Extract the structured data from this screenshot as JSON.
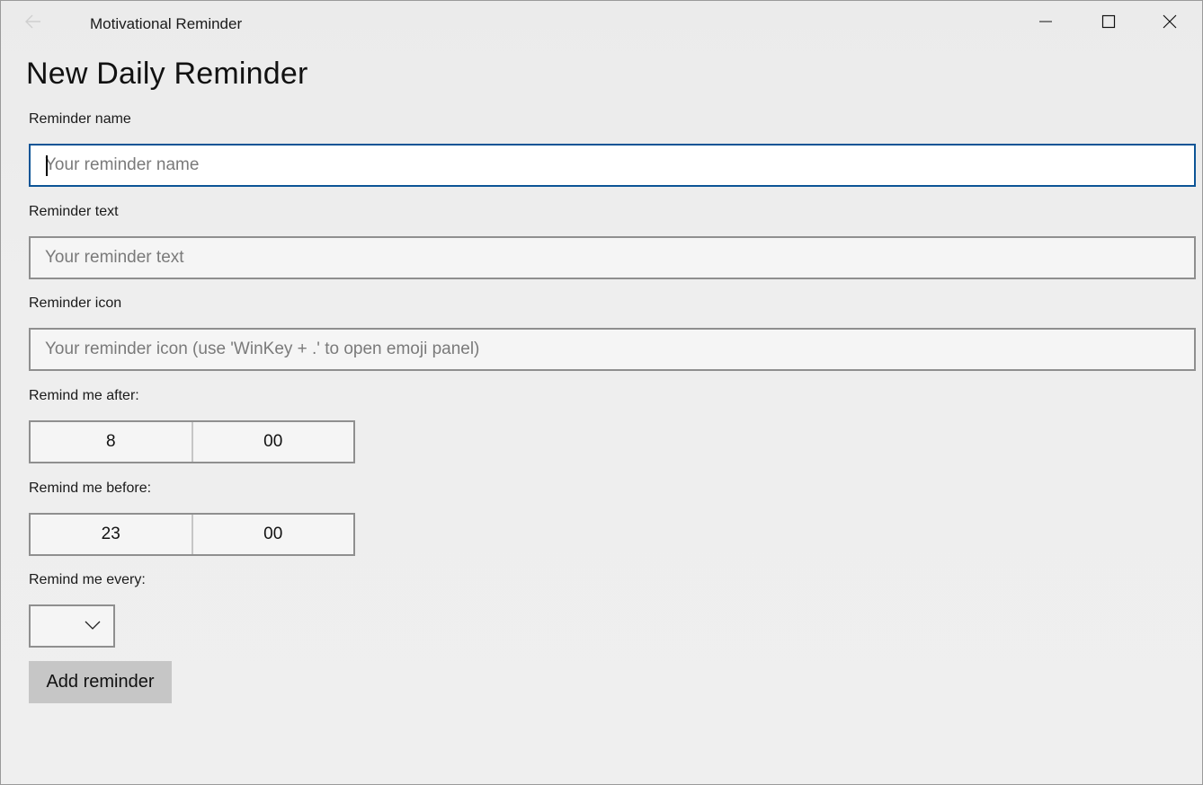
{
  "window": {
    "title": "Motivational Reminder"
  },
  "page": {
    "title": "New Daily Reminder"
  },
  "form": {
    "name_label": "Reminder name",
    "name_placeholder": "Your reminder name",
    "text_label": "Reminder text",
    "text_placeholder": "Your reminder text",
    "icon_label": "Reminder icon",
    "icon_placeholder": "Your reminder icon (use 'WinKey + .' to open emoji panel)",
    "after_label": "Remind me after:",
    "after_hour": "8",
    "after_minute": "00",
    "before_label": "Remind me before:",
    "before_hour": "23",
    "before_minute": "00",
    "every_label": "Remind me every:",
    "every_value": "",
    "submit_label": "Add reminder"
  },
  "icons": {
    "back": "back-arrow-icon",
    "minimize": "minimize-icon",
    "maximize": "maximize-icon",
    "close": "close-icon",
    "dropdown": "chevron-down-icon"
  },
  "colors": {
    "focus_border": "#0d5596",
    "button_bg": "#c6c6c6"
  }
}
